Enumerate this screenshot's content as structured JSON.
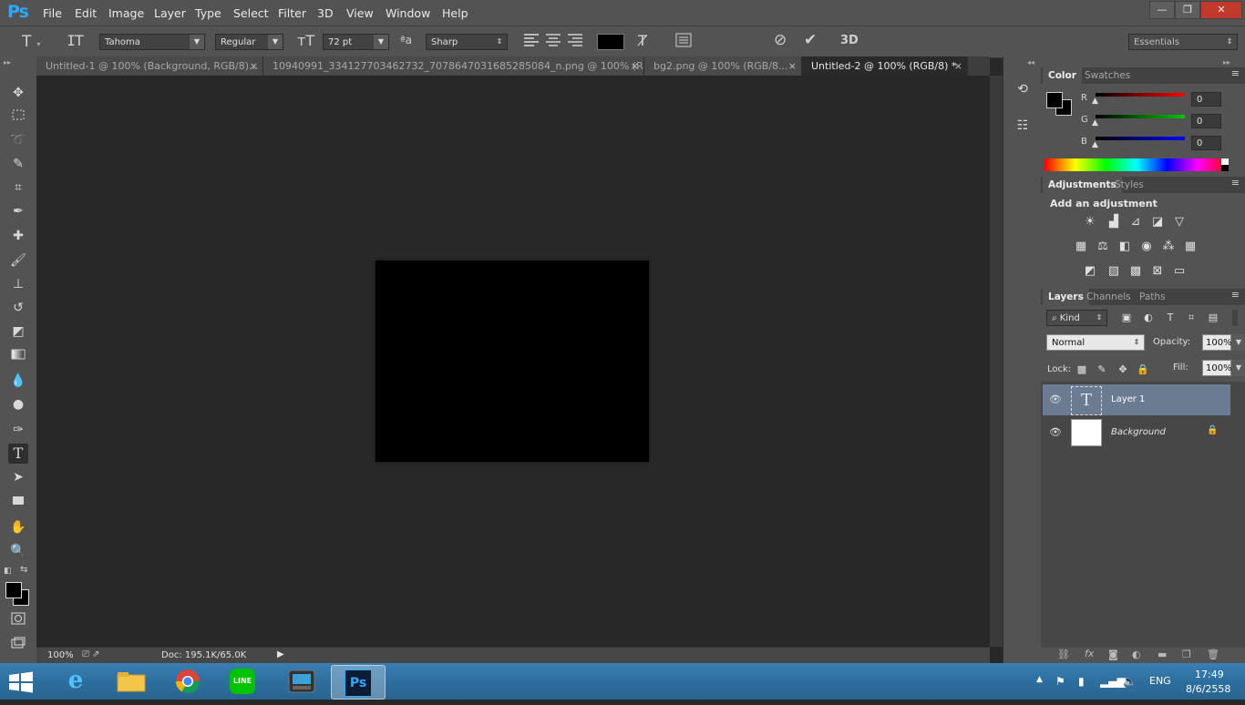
{
  "app": {
    "logo": "Ps"
  },
  "menu": [
    "File",
    "Edit",
    "Image",
    "Layer",
    "Type",
    "Select",
    "Filter",
    "3D",
    "View",
    "Window",
    "Help"
  ],
  "window_controls": {
    "minimize": "—",
    "restore": "❐",
    "close": "✕"
  },
  "options": {
    "font_family": "Tahoma",
    "font_style": "Regular",
    "font_size": "72 pt",
    "aa_label": "ªa",
    "antialias": "Sharp",
    "text_color": "#000000",
    "three_d": "3D",
    "workspace": "Essentials"
  },
  "tabs": [
    {
      "label": "Untitled-1 @ 100% (Background, RGB/8)...",
      "close": "×"
    },
    {
      "label": "10940991_334127703462732_7078647031685285084_n.png @ 100% (RGB/...",
      "close": "×"
    },
    {
      "label": "bg2.png @ 100% (RGB/8...",
      "close": "×"
    },
    {
      "label": "Untitled-2 @ 100% (RGB/8) *",
      "close": "×"
    }
  ],
  "status": {
    "zoom": "100%",
    "doc": "Doc: 195.1K/65.0K"
  },
  "color_panel": {
    "tabs": [
      "Color",
      "Swatches"
    ],
    "channels": [
      {
        "name": "R",
        "value": "0",
        "color": "#ff0000"
      },
      {
        "name": "G",
        "value": "0",
        "color": "#00c800"
      },
      {
        "name": "B",
        "value": "0",
        "color": "#0000ff"
      }
    ]
  },
  "adjustments_panel": {
    "tabs": [
      "Adjustments",
      "Styles"
    ],
    "heading": "Add an adjustment"
  },
  "layers_panel": {
    "tabs": [
      "Layers",
      "Channels",
      "Paths"
    ],
    "filter_kind": "Kind",
    "blend_mode": "Normal",
    "opacity_label": "Opacity:",
    "opacity": "100%",
    "lock_label": "Lock:",
    "fill_label": "Fill:",
    "fill": "100%",
    "layers": [
      {
        "name": "Layer 1",
        "thumb": "T",
        "selected": true
      },
      {
        "name": "Background",
        "thumb": "",
        "selected": false
      }
    ]
  },
  "taskbar": {
    "lang": "ENG",
    "time": "17:49",
    "date": "8/6/2558",
    "apps": [
      "ie",
      "explorer",
      "chrome",
      "line",
      "media",
      "photoshop"
    ],
    "line_label": "LINE",
    "ps_label": "Ps"
  }
}
